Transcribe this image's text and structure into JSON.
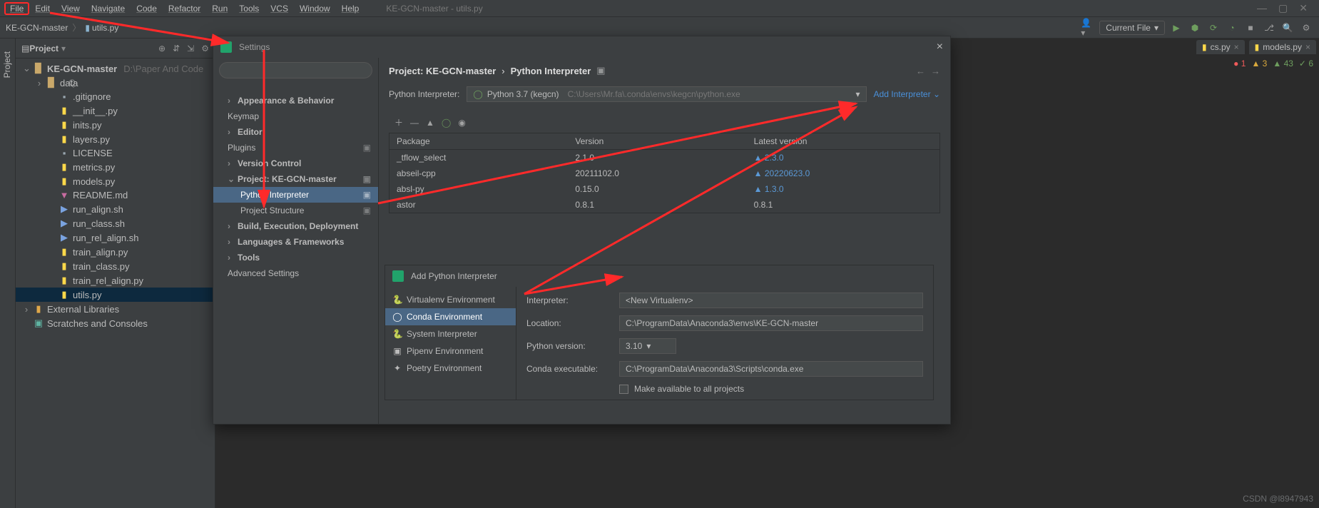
{
  "menu": {
    "items": [
      "File",
      "Edit",
      "View",
      "Navigate",
      "Code",
      "Refactor",
      "Run",
      "Tools",
      "VCS",
      "Window",
      "Help"
    ]
  },
  "window_title": "KE-GCN-master - utils.py",
  "breadcrumbs": {
    "project": "KE-GCN-master",
    "file": "utils.py"
  },
  "run_config": "Current File",
  "project_panel": {
    "title": "Project",
    "root": "KE-GCN-master",
    "root_path": "D:\\Paper And Code",
    "items": [
      {
        "label": "data",
        "kind": "folder",
        "expandable": true
      },
      {
        "label": ".gitignore",
        "kind": "txt"
      },
      {
        "label": "__init__.py",
        "kind": "py"
      },
      {
        "label": "inits.py",
        "kind": "py"
      },
      {
        "label": "layers.py",
        "kind": "py"
      },
      {
        "label": "LICENSE",
        "kind": "txt"
      },
      {
        "label": "metrics.py",
        "kind": "py"
      },
      {
        "label": "models.py",
        "kind": "py"
      },
      {
        "label": "README.md",
        "kind": "md"
      },
      {
        "label": "run_align.sh",
        "kind": "sh"
      },
      {
        "label": "run_class.sh",
        "kind": "sh"
      },
      {
        "label": "run_rel_align.sh",
        "kind": "sh"
      },
      {
        "label": "train_align.py",
        "kind": "py"
      },
      {
        "label": "train_class.py",
        "kind": "py"
      },
      {
        "label": "train_rel_align.py",
        "kind": "py"
      },
      {
        "label": "utils.py",
        "kind": "py",
        "selected": true
      }
    ],
    "external": "External Libraries",
    "scratches": "Scratches and Consoles"
  },
  "editor_tabs": [
    {
      "label": "cs.py"
    },
    {
      "label": "models.py"
    }
  ],
  "inspections": {
    "errors": "1",
    "warnings": "3",
    "weak": "43",
    "ok": "6"
  },
  "settings": {
    "title": "Settings",
    "search_placeholder": "",
    "tree": [
      {
        "label": "Appearance & Behavior",
        "type": "h1",
        "chev": "›"
      },
      {
        "label": "Keymap",
        "type": "item"
      },
      {
        "label": "Editor",
        "type": "h1",
        "chev": "›"
      },
      {
        "label": "Plugins",
        "type": "item",
        "cog": true
      },
      {
        "label": "Version Control",
        "type": "h1",
        "chev": "›"
      },
      {
        "label": "Project: KE-GCN-master",
        "type": "h1",
        "chev": "⌄",
        "cog": true
      },
      {
        "label": "Python Interpreter",
        "type": "sub",
        "selected": true,
        "cog": true
      },
      {
        "label": "Project Structure",
        "type": "sub",
        "cog": true
      },
      {
        "label": "Build, Execution, Deployment",
        "type": "h1",
        "chev": "›"
      },
      {
        "label": "Languages & Frameworks",
        "type": "h1",
        "chev": "›"
      },
      {
        "label": "Tools",
        "type": "h1",
        "chev": "›"
      },
      {
        "label": "Advanced Settings",
        "type": "item"
      }
    ],
    "content": {
      "crumb_project": "Project: KE-GCN-master",
      "crumb_sep": "›",
      "crumb_page": "Python Interpreter",
      "label_interpreter": "Python Interpreter:",
      "interpreter_name": "Python 3.7 (kegcn)",
      "interpreter_path": "C:\\Users\\Mr.fa\\.conda\\envs\\kegcn\\python.exe",
      "add_link": "Add Interpreter",
      "columns": {
        "pkg": "Package",
        "ver": "Version",
        "latest": "Latest version"
      },
      "rows": [
        {
          "pkg": "_tflow_select",
          "ver": "2.1.0",
          "latest": "2.3.0",
          "up": true
        },
        {
          "pkg": "abseil-cpp",
          "ver": "20211102.0",
          "latest": "20220623.0",
          "up": true
        },
        {
          "pkg": "absl-py",
          "ver": "0.15.0",
          "latest": "1.3.0",
          "up": true
        },
        {
          "pkg": "astor",
          "ver": "0.8.1",
          "latest": "0.8.1",
          "up": false
        }
      ]
    }
  },
  "add_interp": {
    "title": "Add Python Interpreter",
    "envs": [
      "Virtualenv Environment",
      "Conda Environment",
      "System Interpreter",
      "Pipenv Environment",
      "Poetry Environment"
    ],
    "selected_env_index": 1,
    "label_interpreter": "Interpreter:",
    "val_interpreter": "<New Virtualenv>",
    "label_location": "Location:",
    "val_location": "C:\\ProgramData\\Anaconda3\\envs\\KE-GCN-master",
    "label_pyver": "Python version:",
    "val_pyver": "3.10",
    "label_conda": "Conda executable:",
    "val_conda": "C:\\ProgramData\\Anaconda3\\Scripts\\conda.exe",
    "chk_label": "Make available to all projects"
  },
  "watermark": "CSDN @l8947943"
}
